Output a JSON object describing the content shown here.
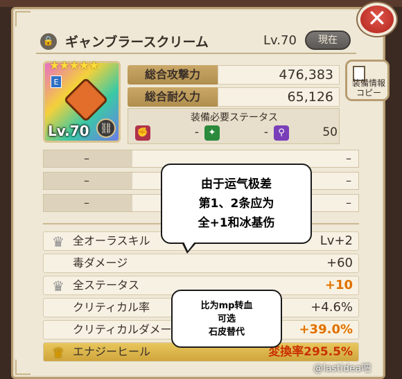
{
  "header": {
    "item_name": "ギャンブラースクリーム",
    "level": "Lv.70",
    "current_button": "現在"
  },
  "card": {
    "stars": "★★★★★",
    "rank": "E",
    "level": "Lv.70"
  },
  "stats": {
    "attack_label": "総合攻撃力",
    "attack_value": "476,383",
    "durability_label": "総合耐久力",
    "durability_value": "65,126"
  },
  "copy_button": {
    "label_line1": "装備情報",
    "label_line2": "コピー"
  },
  "requirements": {
    "title": "装備必要ステータス",
    "items": [
      {
        "icon": "fist-icon",
        "value": "-",
        "color": "#b0324a"
      },
      {
        "icon": "sparkle-icon",
        "value": "-",
        "color": "#2c8a3c"
      },
      {
        "icon": "wand-icon",
        "value": "50",
        "color": "#7a3fb8"
      }
    ]
  },
  "sub_slots": [
    {
      "left": "–",
      "right": "–"
    },
    {
      "left": "–",
      "right": "–"
    },
    {
      "left": "–",
      "right": "–"
    }
  ],
  "skills": [
    {
      "name": "全オーラスキル",
      "value": "Lv+2",
      "crown": "silver"
    },
    {
      "name": "毒ダメージ",
      "value": "+60",
      "crown": "none"
    },
    {
      "name": "全ステータス",
      "value": "+10",
      "crown": "silver"
    },
    {
      "name": "クリティカル率",
      "value": "+4.6%",
      "crown": "none"
    },
    {
      "name": "クリティカルダメー",
      "value": "+39.0%",
      "crown": "none"
    },
    {
      "name": "エナジーヒール",
      "value": "変換率295.5%",
      "crown": "gold"
    }
  ],
  "annotations": {
    "bubble1": [
      "由于运气极差",
      "第1、2条应为",
      "全+1和冰基伤"
    ],
    "bubble2": [
      "比为mp转血",
      "可选",
      "石皮替代"
    ]
  },
  "watermark": "@lastidea吧",
  "colors": {
    "accent_gold": "#cfa53c",
    "close_red": "#b0231c",
    "highlight_orange": "#e07000"
  }
}
